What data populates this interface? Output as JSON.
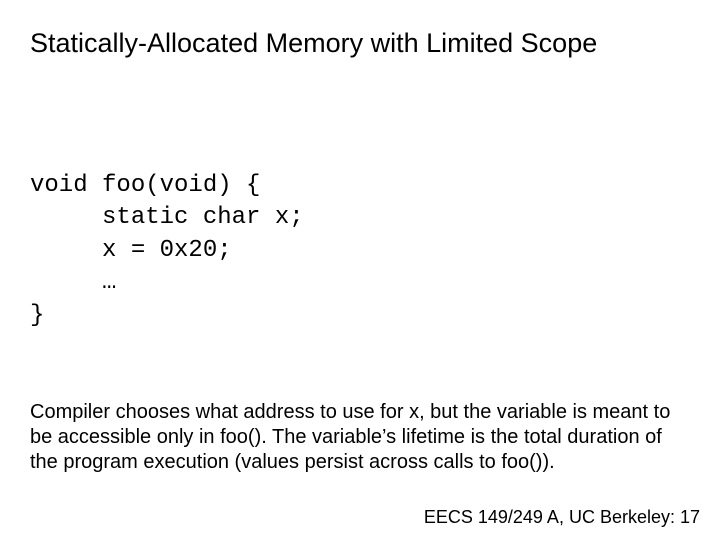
{
  "title": "Statically-Allocated Memory with Limited Scope",
  "code": {
    "l1": "void foo(void) {",
    "l2": "     static char x;",
    "l3": "     x = 0x20;",
    "l4": "     …",
    "l5": "}"
  },
  "body": "Compiler chooses what address to use for x, but the variable is meant to be accessible only in foo(). The variable’s lifetime is the total duration of the program execution (values persist across calls to foo()).",
  "footer": "EECS 149/249 A, UC Berkeley: 17"
}
